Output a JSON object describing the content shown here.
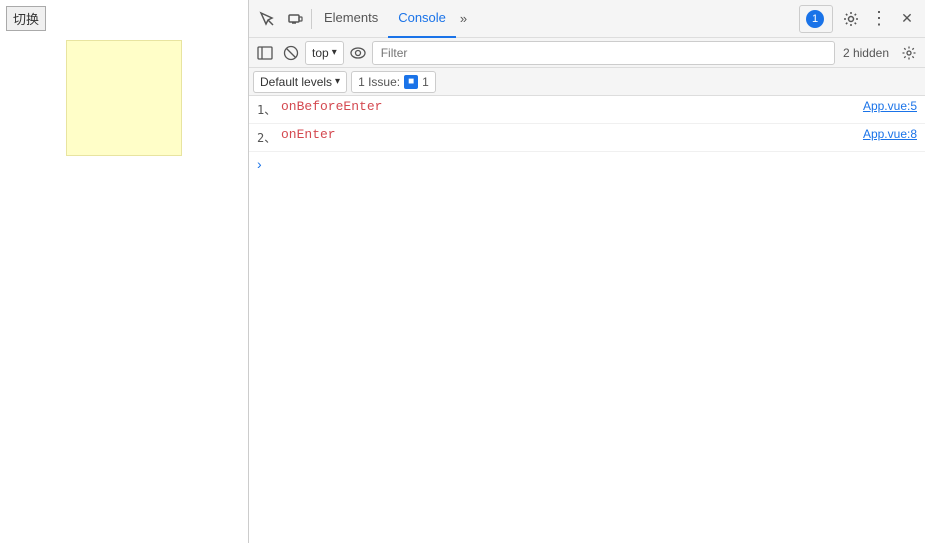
{
  "webpage": {
    "switch_button": "切换"
  },
  "devtools": {
    "toolbar": {
      "inspect_icon": "⬚",
      "device_icon": "⬜",
      "elements_tab": "Elements",
      "console_tab": "Console",
      "more_tabs_icon": "»",
      "notification_count": "1",
      "settings_icon": "⚙",
      "more_icon": "⋮",
      "close_icon": "✕"
    },
    "console_toolbar": {
      "sidebar_icon": "▦",
      "clear_icon": "⊘",
      "context_label": "top",
      "context_arrow": "▾",
      "eye_icon": "👁",
      "filter_placeholder": "Filter",
      "hidden_count": "2 hidden",
      "settings_icon": "⚙"
    },
    "log_levels": {
      "label": "Default levels",
      "arrow": "▾",
      "issues_label": "1 Issue:",
      "issues_count": "1"
    },
    "console_entries": [
      {
        "number": "1、",
        "text": "onBeforeEnter",
        "source": "App.vue:5"
      },
      {
        "number": "2、",
        "text": "onEnter",
        "source": "App.vue:8"
      }
    ],
    "prompt": ">"
  }
}
